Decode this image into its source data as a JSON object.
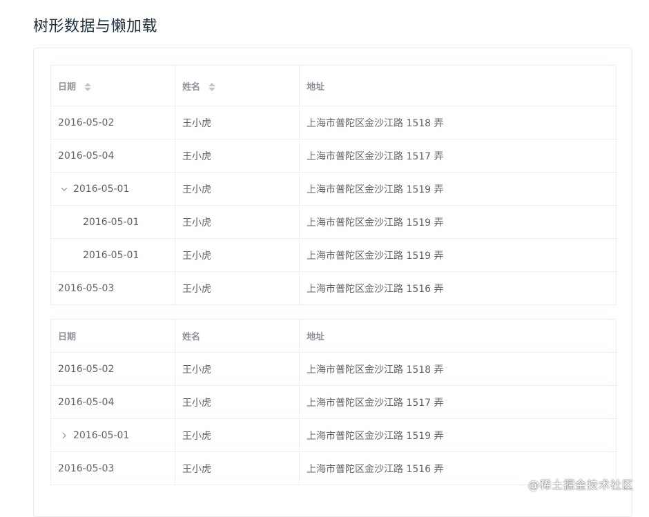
{
  "page_title": "树形数据与懒加载",
  "colors": {
    "header_text": "#909399",
    "cell_text": "#606266",
    "border": "#ebeef5",
    "title": "#1f2f3d"
  },
  "table1": {
    "headers": {
      "date": "日期",
      "name": "姓名",
      "address": "地址"
    },
    "rows": [
      {
        "date": "2016-05-02",
        "name": "王小虎",
        "address": "上海市普陀区金沙江路 1518 弄"
      },
      {
        "date": "2016-05-04",
        "name": "王小虎",
        "address": "上海市普陀区金沙江路 1517 弄"
      },
      {
        "date": "2016-05-01",
        "name": "王小虎",
        "address": "上海市普陀区金沙江路 1519 弄",
        "expanded": true
      },
      {
        "date": "2016-05-01",
        "name": "王小虎",
        "address": "上海市普陀区金沙江路 1519 弄",
        "child": true
      },
      {
        "date": "2016-05-01",
        "name": "王小虎",
        "address": "上海市普陀区金沙江路 1519 弄",
        "child": true
      },
      {
        "date": "2016-05-03",
        "name": "王小虎",
        "address": "上海市普陀区金沙江路 1516 弄"
      }
    ]
  },
  "table2": {
    "headers": {
      "date": "日期",
      "name": "姓名",
      "address": "地址"
    },
    "rows": [
      {
        "date": "2016-05-02",
        "name": "王小虎",
        "address": "上海市普陀区金沙江路 1518 弄"
      },
      {
        "date": "2016-05-04",
        "name": "王小虎",
        "address": "上海市普陀区金沙江路 1517 弄"
      },
      {
        "date": "2016-05-01",
        "name": "王小虎",
        "address": "上海市普陀区金沙江路 1519 弄",
        "expanded": false
      },
      {
        "date": "2016-05-03",
        "name": "王小虎",
        "address": "上海市普陀区金沙江路 1516 弄"
      }
    ]
  },
  "watermark": "@稀土掘金技术社区"
}
